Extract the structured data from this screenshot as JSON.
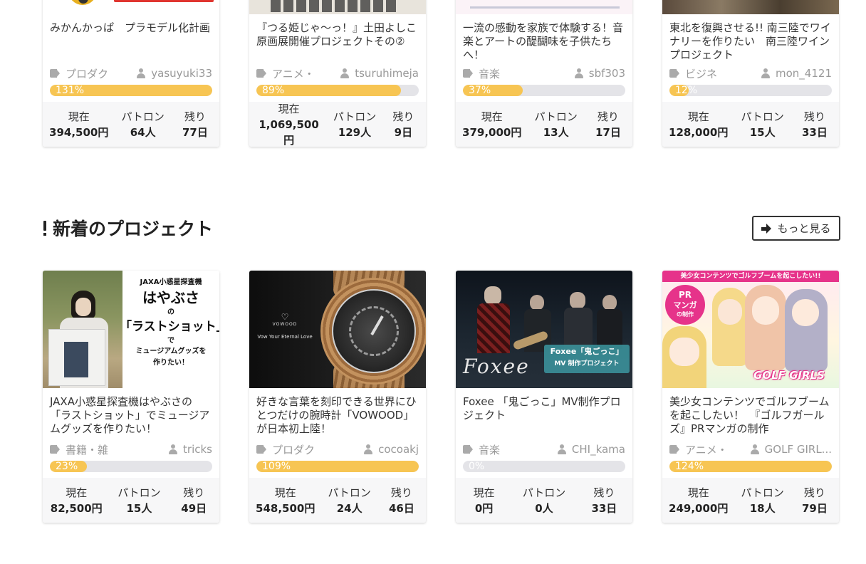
{
  "stat_labels": {
    "now": "現在",
    "patron": "パトロン",
    "remain": "残り"
  },
  "top_projects": [
    {
      "title": "みかんかっぱ　プラモデル化計画",
      "category": "プロダク",
      "user": "yasuyuki33",
      "percent_label": "131%",
      "progress": 1.31,
      "now": "394,500円",
      "patrons": "64人",
      "remain": "77日"
    },
    {
      "title": "『つる姫じゃ～っ！』土田よしこ原画展開催プロジェクトその②",
      "category": "アニメ・",
      "user": "tsuruhimeja",
      "percent_label": "89%",
      "progress": 0.89,
      "now": "1,069,500円",
      "patrons": "129人",
      "remain": "9日"
    },
    {
      "title": "一流の感動を家族で体験する！音楽とアートの醍醐味を子供たちへ！",
      "category": "音楽",
      "user": "sbf303",
      "percent_label": "37%",
      "progress": 0.37,
      "now": "379,000円",
      "patrons": "13人",
      "remain": "17日"
    },
    {
      "title": "東北を復興させる!! 南三陸でワイナリーを作りたい　南三陸ワインプロジェクト",
      "category": "ビジネ",
      "user": "mon_4121",
      "percent_label": "12%",
      "progress": 0.12,
      "now": "128,000円",
      "patrons": "15人",
      "remain": "33日"
    }
  ],
  "section": {
    "title": "新着のプロジェクト",
    "more_label": "もっと見る"
  },
  "new_projects": [
    {
      "title": "JAXA小惑星探査機はやぶさの「ラストショット」でミュージアムグッズを作りたい！",
      "category": "書籍・雑",
      "user": "tricks",
      "percent_label": "23%",
      "progress": 0.23,
      "now": "82,500円",
      "patrons": "15人",
      "remain": "49日",
      "image_text": {
        "l1": "JAXA小惑星探査機",
        "l2": "はやぶさ",
        "l3": "の",
        "l4": "「ラストショット」",
        "l5": "で",
        "l6": "ミュージアムグッズを",
        "l7": "作りたい！"
      }
    },
    {
      "title": "好きな言葉を刻印できる世界にひとつだけの腕時計「VOWOOD」が日本初上陸！",
      "category": "プロダク",
      "user": "cocoakj",
      "percent_label": "109%",
      "progress": 1.09,
      "now": "548,500円",
      "patrons": "24人",
      "remain": "46日",
      "image_text": {
        "brand": "VOWOOD",
        "tagline": "Vow Your Eternal Love"
      }
    },
    {
      "title": "Foxee 「鬼ごっこ」MV制作プロジェクト",
      "category": "音楽",
      "user": "CHI_kama",
      "percent_label": "0%",
      "progress": 0,
      "now": "0円",
      "patrons": "0人",
      "remain": "33日",
      "image_text": {
        "logo": "Foxee",
        "banner1": "Foxee「鬼ごっこ」",
        "banner2": "MV 制作プロジェクト"
      }
    },
    {
      "title": "美少女コンテンツでゴルフブームを起こしたい！　『ゴルフガールズ』PRマンガの制作",
      "category": "アニメ・",
      "user": "GOLF GIRL...",
      "percent_label": "124%",
      "progress": 1.24,
      "now": "249,000円",
      "patrons": "18人",
      "remain": "79日",
      "image_text": {
        "banner": "美少女コンテンツでゴルフブームを起こしたい!!",
        "badge1": "PR",
        "badge2": "マンガ",
        "badge3": "の制作",
        "logo": "GOLF GIRLS"
      }
    }
  ],
  "colors": {
    "progress_fill": "#f7c553",
    "progress_track": "#e4e4e8",
    "stats_bg": "#f7f7f8"
  }
}
